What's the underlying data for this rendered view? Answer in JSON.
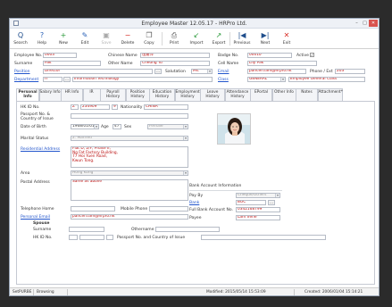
{
  "window": {
    "title": "Employee Master 12.05.17 - HRPro Ltd."
  },
  "toolbar": [
    {
      "label": "Search",
      "icon": "Q",
      "color": "#1f4e8c",
      "disabled": false
    },
    {
      "label": "Help",
      "icon": "?",
      "color": "#2b62b8",
      "disabled": false
    },
    {
      "label": "New",
      "icon": "+",
      "color": "#2a9a3a",
      "disabled": false
    },
    {
      "label": "Edit",
      "icon": "✎",
      "color": "#2b62b8",
      "disabled": false
    },
    {
      "label": "Save",
      "icon": "▣",
      "color": "#aaaaaa",
      "disabled": true
    },
    {
      "label": "Delete",
      "icon": "−",
      "color": "#d8322a",
      "disabled": false
    },
    {
      "label": "Copy",
      "icon": "❐",
      "color": "#555555",
      "disabled": false
    },
    {
      "label": "Print",
      "icon": "⎙",
      "color": "#555555",
      "disabled": false
    },
    {
      "label": "Import",
      "icon": "↙",
      "color": "#2a9a3a",
      "disabled": false
    },
    {
      "label": "Export",
      "icon": "↗",
      "color": "#2a9a3a",
      "disabled": false
    },
    {
      "label": "Previous",
      "icon": "|◀",
      "color": "#1f4e8c",
      "disabled": false
    },
    {
      "label": "Next",
      "icon": "▶|",
      "color": "#1f4e8c",
      "disabled": false
    },
    {
      "label": "Exit",
      "icon": "✕",
      "color": "#d8322a",
      "disabled": false
    }
  ],
  "header": {
    "employee_no_label": "Employee No.",
    "employee_no": "0003",
    "chinese_name_label": "Chinese Name",
    "chinese_name": "伍嘉萍",
    "badge_no_label": "Badge No.",
    "badge_no": "00010",
    "active_label": "Active",
    "active_checked": "✓",
    "surname_label": "Surname",
    "surname": "Pak",
    "other_name_label": "Other Name",
    "other_name": "Cheung Yu",
    "cell_name_label": "Cell Name",
    "cell_name": "Lily Pak",
    "position_label": "Position",
    "position": "Director",
    "salutation_label": "Salutation",
    "salutation": "Ms.",
    "email_label": "Email",
    "email": "pancen.lam@hrpro.hk",
    "phone_ext_label": "Phone / Ext",
    "phone_ext": "203",
    "department_label": "Department",
    "department_code": "IT",
    "department_name": "Information Technology",
    "class_label": "Class",
    "class_code": "GENERAL",
    "class_name": "Employee General Class"
  },
  "tabs": [
    "Personal Info",
    "Salary Info",
    "HR Info",
    "IR",
    "Payroll History",
    "Position History",
    "Education History",
    "Employment History",
    "Leave History",
    "Attendance History",
    "EPortal",
    "Other Info",
    "Notes",
    "Attachment*"
  ],
  "personal": {
    "hkid_label": "HK ID No.",
    "hkid_prefix": "Z",
    "hkid_number": "234909",
    "hkid_check": "9",
    "nationality_label": "Nationality",
    "nationality": "CHINA",
    "passport_label": "Passport No. & Country of Issue",
    "dob_label": "Date of Birth",
    "dob": "1968/01/01",
    "age_label": "Age",
    "age": "47",
    "sex_label": "Sex",
    "sex": "Female",
    "marital_label": "Marital Status",
    "marital": "2. Married",
    "residential_label": "Residential Address",
    "residential_lines": [
      "Flat D, 2/F, Phase II,",
      "Ng Fat Factory Building,",
      "77 Hoi Yuen Road,",
      "Kwun Tong."
    ],
    "area_label": "Area",
    "area": "Hong Kong",
    "postal_label": "Postal Address",
    "postal": "Same as above",
    "telephone_home_label": "Telephone Home",
    "mobile_phone_label": "Mobile Phone",
    "personal_email_label": "Personal Email",
    "personal_email": "pancen.lam@hrpro.hk",
    "bank_group_label": "Bank Account Information",
    "pay_by_label": "Pay By",
    "pay_by": "Cheque/Others",
    "bank_label": "Bank",
    "bank": "BOC",
    "full_bank_label": "Full Bank Account No.",
    "full_bank": "0342168799",
    "payee_label": "Payee",
    "payee": "Lam Irene",
    "spouse_group_label": "Spouse",
    "spouse_surname_label": "Surname",
    "othername_label": "Othername",
    "spouse_hkid_label": "HK ID No.",
    "spouse_passport_label": "Passport No. and Country of Issue"
  },
  "status": {
    "user": "SetPURBE",
    "mode": "Browsing",
    "modified": "Modified: 2015/05/14 15:53:09",
    "created": "Created: 2006/01/04 15:14:21"
  }
}
